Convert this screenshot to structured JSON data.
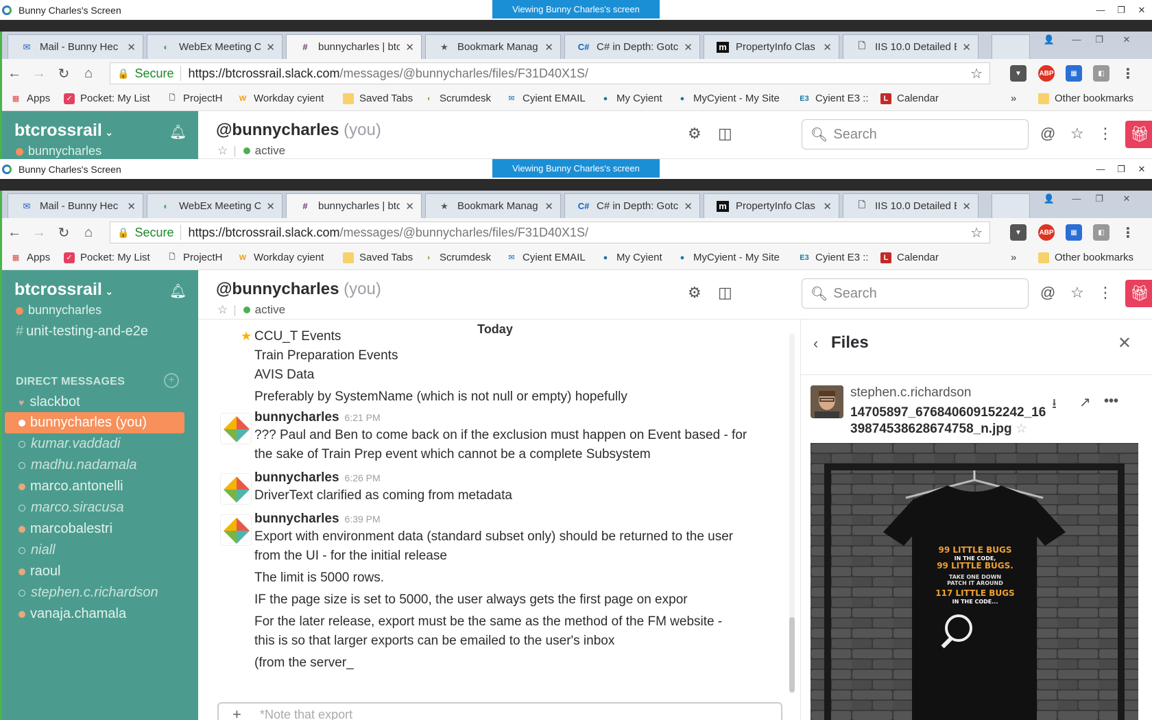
{
  "viewer": {
    "title": "Bunny Charles's Screen",
    "banner": "Viewing Bunny Charles's screen"
  },
  "browser": {
    "tabs": [
      {
        "label": "Mail - Bunny Hec",
        "icon": "mail-icon"
      },
      {
        "label": "WebEx Meeting C",
        "icon": "webex-icon"
      },
      {
        "label": "bunnycharles | btc",
        "icon": "slack-icon"
      },
      {
        "label": "Bookmark Manag",
        "icon": "star-icon"
      },
      {
        "label": "C# in Depth: Gotc",
        "icon": "csharp-icon"
      },
      {
        "label": "PropertyInfo Clas",
        "icon": "msdn-icon"
      },
      {
        "label": "IIS 10.0 Detailed E",
        "icon": "document-icon"
      }
    ],
    "address": {
      "secure_label": "Secure",
      "url_host": "https://btcrossrail.slack.com",
      "url_path": "/messages/@bunnycharles/files/F31D40X1S/"
    },
    "bookmarks": [
      {
        "label": "Apps",
        "icon": "apps-grid-icon"
      },
      {
        "label": "Pocket: My List",
        "icon": "pocket-icon"
      },
      {
        "label": "ProjectH",
        "icon": "page-icon"
      },
      {
        "label": "Workday cyient",
        "icon": "workday-icon"
      },
      {
        "label": "Saved Tabs",
        "icon": "folder-icon"
      },
      {
        "label": "Scrumdesk",
        "icon": "scrumdesk-icon"
      },
      {
        "label": "Cyient EMAIL",
        "icon": "mail-icon"
      },
      {
        "label": "My Cyient",
        "icon": "dot-icon"
      },
      {
        "label": "MyCyient - My Site",
        "icon": "dot-icon"
      },
      {
        "label": "Cyient E3 ::",
        "icon": "e3-icon"
      },
      {
        "label": "Calendar",
        "icon": "calendar-icon"
      }
    ],
    "more_label": "»",
    "other_bookmarks": "Other bookmarks"
  },
  "slack": {
    "team": "btcrossrail",
    "me": "bunnycharles",
    "channel": "unit-testing-and-e2e",
    "dm_header": "DIRECT MESSAGES",
    "dms": [
      {
        "name": "slackbot",
        "state": "bot"
      },
      {
        "name": "bunnycharles (you)",
        "state": "selected"
      },
      {
        "name": "kumar.vaddadi",
        "state": "away"
      },
      {
        "name": "madhu.nadamala",
        "state": "away"
      },
      {
        "name": "marco.antonelli",
        "state": "online"
      },
      {
        "name": "marco.siracusa",
        "state": "away"
      },
      {
        "name": "marcobalestri",
        "state": "online"
      },
      {
        "name": "niall",
        "state": "away"
      },
      {
        "name": "raoul",
        "state": "online"
      },
      {
        "name": "stephen.c.richardson",
        "state": "away"
      },
      {
        "name": "vanaja.chamala",
        "state": "online"
      }
    ],
    "header": {
      "name": "@bunnycharles",
      "you": "(you)",
      "status": "active",
      "search_placeholder": "Search"
    },
    "messages": {
      "divider": "Today",
      "pre_lines": [
        "CCU_T Events",
        "Train Preparation Events",
        "AVIS Data",
        "Preferably by SystemName (which is not null or empty) hopefully"
      ],
      "m1": {
        "author": "bunnycharles",
        "time": "6:21 PM",
        "line1": "??? Paul and Ben to come back on if the exclusion must happen on Event based - for",
        "line2": "the sake of Train Prep event which cannot be a complete Subsystem"
      },
      "m2": {
        "author": "bunnycharles",
        "time": "6:26 PM",
        "line1": "DriverText clarified as coming from metadata"
      },
      "m3": {
        "author": "bunnycharles",
        "time": "6:39 PM",
        "lines": [
          "Export with environment data (standard subset only) should be returned to the user",
          "from the UI - for the initial release",
          "The limit is 5000 rows.",
          "IF the page size is set to 5000, the user always gets the first page on expor",
          "For the later release, export must be the same as the method of the FM website -",
          "this is so that larger exports can be emailed to the user's inbox",
          "(from the server_"
        ]
      },
      "composer_placeholder": "*Note that export"
    },
    "files": {
      "title": "Files",
      "uploader": "stephen.c.richardson",
      "filename": "14705897_676840609152242_1639874538628674758_n.jpg",
      "shirt_text": [
        "99 LITTLE BUGS",
        "IN THE CODE,",
        "99 LITTLE BUGS.",
        "TAKE ONE DOWN",
        "PATCH IT AROUND",
        "117 LITTLE BUGS",
        "IN THE CODE..."
      ]
    }
  },
  "colors": {
    "sidebar": "#4b9c8e",
    "selected": "#f7905b",
    "banner": "#1b8fd6"
  }
}
